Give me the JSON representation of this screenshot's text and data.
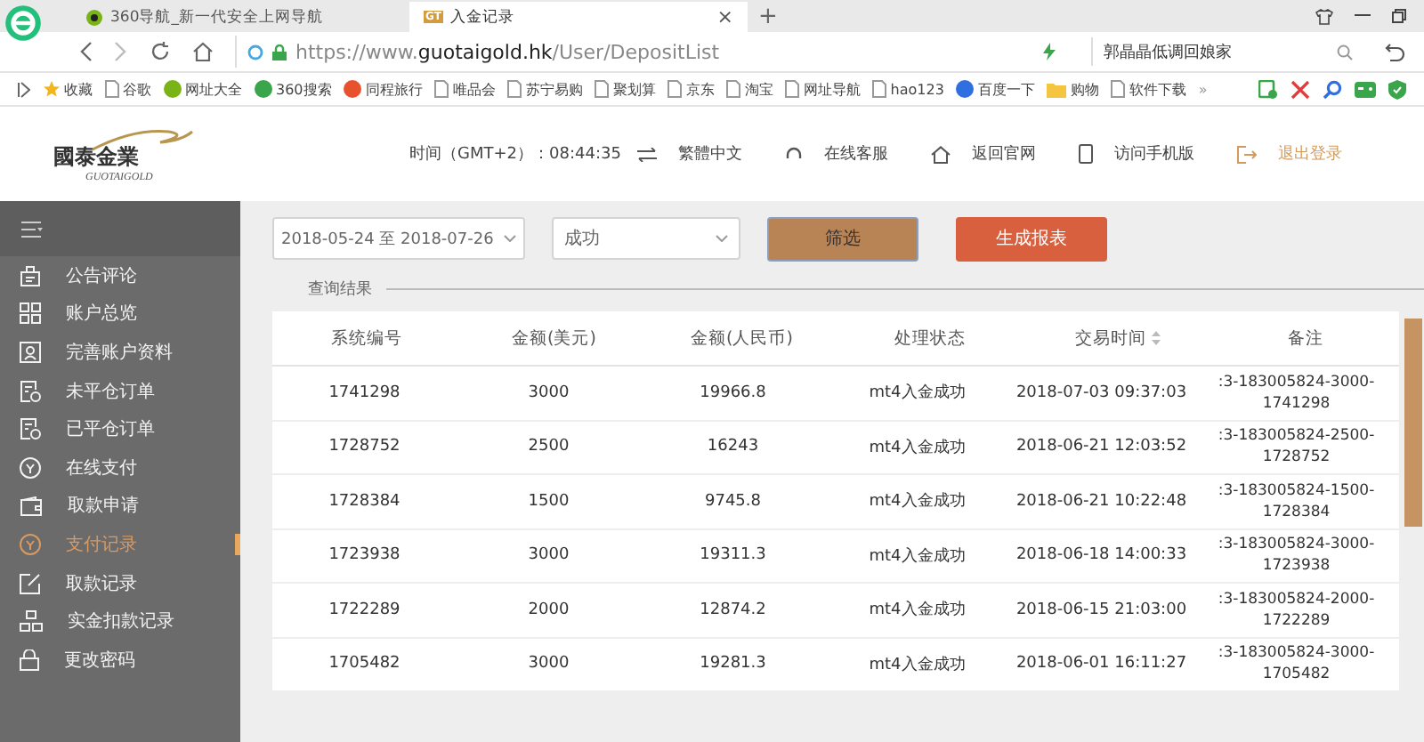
{
  "browser": {
    "tabs": [
      {
        "label": "360导航_新一代安全上网导航",
        "selected": false
      },
      {
        "label": "入金记录",
        "favicon_text": "GT",
        "close": "×",
        "selected": true
      }
    ],
    "new_tab": "+",
    "address": "https://www.**guotaigold.hk**/User/DepositList",
    "search_value": "郭晶晶低调回娘家",
    "bookmarks": [
      {
        "label": "收藏",
        "kind": "star"
      },
      {
        "label": "谷歌",
        "kind": "page"
      },
      {
        "label": "网址大全",
        "kind": "logo",
        "color": "#7ab317"
      },
      {
        "label": "360搜索",
        "kind": "logo",
        "color": "#3aa54a"
      },
      {
        "label": "同程旅行",
        "kind": "logo",
        "color": "#e8512d"
      },
      {
        "label": "唯品会",
        "kind": "page"
      },
      {
        "label": "苏宁易购",
        "kind": "page"
      },
      {
        "label": "聚划算",
        "kind": "page"
      },
      {
        "label": "京东",
        "kind": "page"
      },
      {
        "label": "淘宝",
        "kind": "page"
      },
      {
        "label": "网址导航",
        "kind": "page"
      },
      {
        "label": "hao123",
        "kind": "page"
      },
      {
        "label": "百度一下",
        "kind": "logo",
        "color": "#2f6fe0"
      },
      {
        "label": "购物",
        "kind": "folder"
      },
      {
        "label": "软件下载",
        "kind": "page"
      }
    ],
    "more": "»"
  },
  "header": {
    "logo_cn": "國泰金業",
    "logo_en": "GUOTAIGOLD",
    "time": "时间（GMT+2）：08:44:35",
    "links": [
      {
        "label": "繁體中文",
        "kind": "lang"
      },
      {
        "label": "在线客服",
        "kind": "service"
      },
      {
        "label": "返回官网",
        "kind": "home"
      },
      {
        "label": "访问手机版",
        "kind": "mobile"
      },
      {
        "label": "退出登录",
        "kind": "logout"
      }
    ]
  },
  "sidebar": {
    "items": [
      {
        "label": "公告评论",
        "kind": "notice",
        "selected": false
      },
      {
        "label": "账户总览",
        "kind": "grid",
        "selected": false
      },
      {
        "label": "完善账户资料",
        "kind": "profile",
        "selected": false
      },
      {
        "label": "未平仓订单",
        "kind": "doc",
        "selected": false
      },
      {
        "label": "已平仓订单",
        "kind": "doc",
        "selected": false
      },
      {
        "label": "在线支付",
        "kind": "circle",
        "selected": false
      },
      {
        "label": "取款申请",
        "kind": "wallet",
        "selected": false
      },
      {
        "label": "支付记录",
        "kind": "circle",
        "selected": true
      },
      {
        "label": "取款记录",
        "kind": "edit",
        "selected": false
      },
      {
        "label": "实金扣款记录",
        "kind": "nodes",
        "selected": false
      },
      {
        "label": "更改密码",
        "kind": "lock",
        "selected": false
      }
    ]
  },
  "filters": {
    "date_range": "2018-05-24 至 2018-07-26",
    "status": "成功",
    "filter_button": "筛选",
    "report_button": "生成报表"
  },
  "section_title": "查询结果",
  "table": {
    "columns": [
      {
        "label": "系统编号",
        "sortable": false
      },
      {
        "label": "金额(美元)",
        "sortable": false
      },
      {
        "label": "金额(人民币)",
        "sortable": false
      },
      {
        "label": "处理状态",
        "sortable": false
      },
      {
        "label": "交易时间",
        "sortable": true
      },
      {
        "label": "备注",
        "sortable": false
      }
    ],
    "rows": [
      [
        "1741298",
        "3000",
        "19966.8",
        "mt4入金成功",
        "2018-07-03 09:37:03",
        ":3-183005824-3000-1741298"
      ],
      [
        "1728752",
        "2500",
        "16243",
        "mt4入金成功",
        "2018-06-21 12:03:52",
        ":3-183005824-2500-1728752"
      ],
      [
        "1728384",
        "1500",
        "9745.8",
        "mt4入金成功",
        "2018-06-21 10:22:48",
        ":3-183005824-1500-1728384"
      ],
      [
        "1723938",
        "3000",
        "19311.3",
        "mt4入金成功",
        "2018-06-18 14:00:33",
        ":3-183005824-3000-1723938"
      ],
      [
        "1722289",
        "2000",
        "12874.2",
        "mt4入金成功",
        "2018-06-15 21:03:00",
        ":3-183005824-2000-1722289"
      ],
      [
        "1705482",
        "3000",
        "19281.3",
        "mt4入金成功",
        "2018-06-01 16:11:27",
        ":3-183005824-3000-1705482"
      ]
    ]
  }
}
